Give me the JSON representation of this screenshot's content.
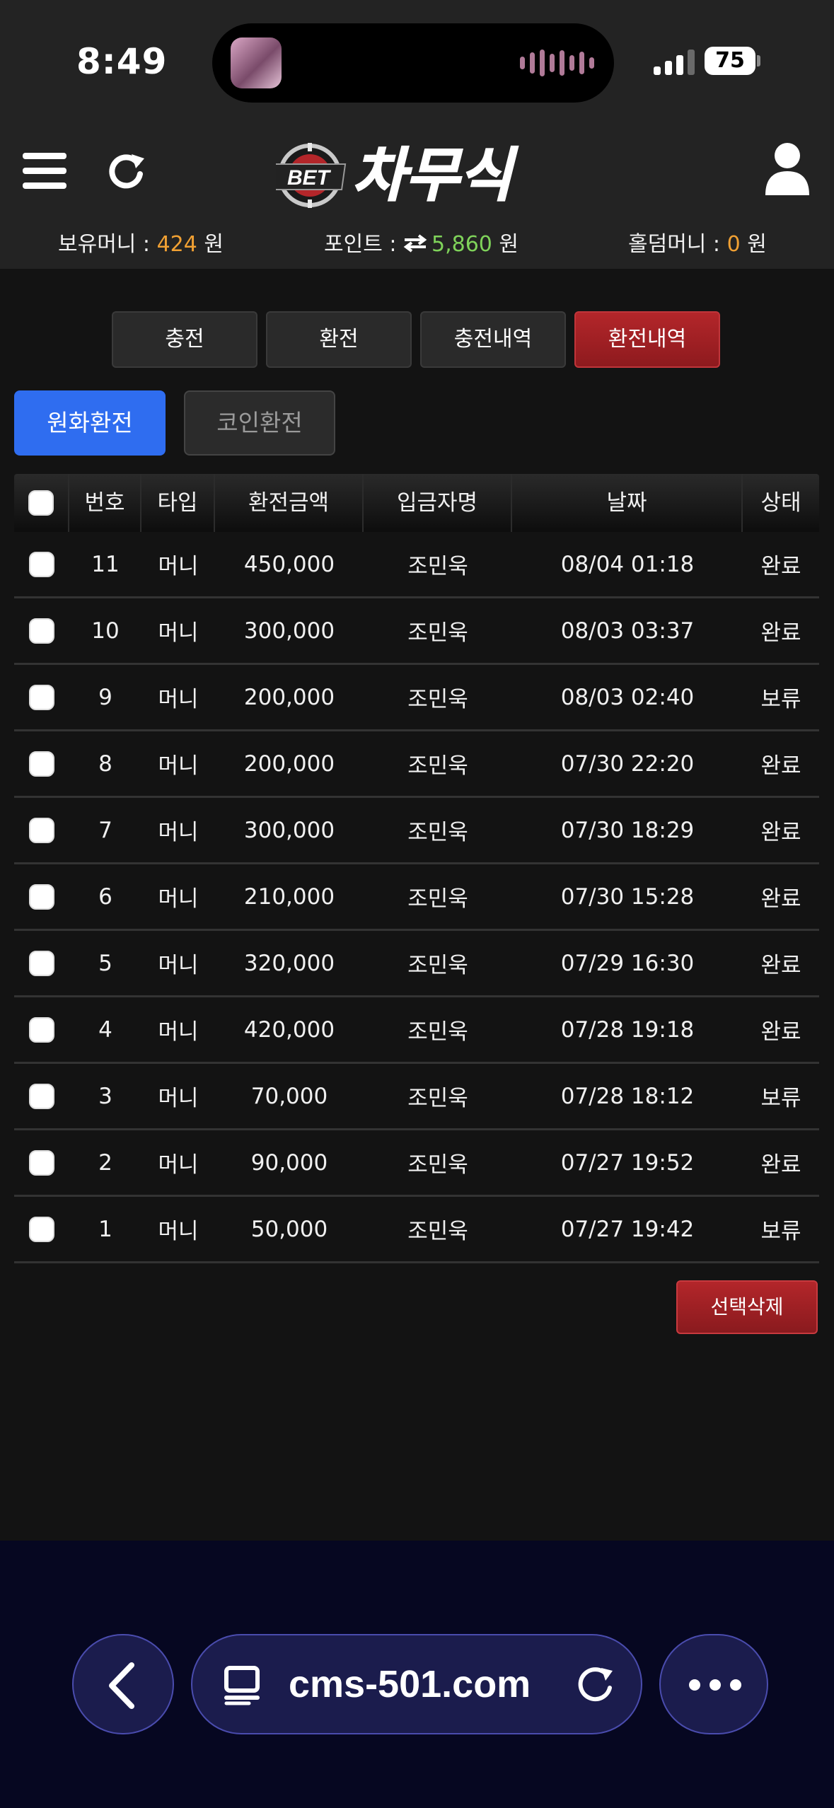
{
  "status_bar": {
    "time": "8:49",
    "battery": "75"
  },
  "header": {
    "logo_text": "차무식",
    "logo_badge": "BET",
    "balances": {
      "money_label": "보유머니 : ",
      "money_value": "424",
      "money_unit": " 원",
      "point_label": "포인트 : ",
      "point_value": "5,860",
      "point_unit": " 원",
      "holdem_label": "홀덤머니 : ",
      "holdem_value": "0",
      "holdem_unit": " 원"
    }
  },
  "tabs": [
    "충전",
    "환전",
    "충전내역",
    "환전내역"
  ],
  "subtabs": [
    "원화환전",
    "코인환전"
  ],
  "table": {
    "headers": [
      "번호",
      "타입",
      "환전금액",
      "입금자명",
      "날짜",
      "상태"
    ],
    "rows": [
      {
        "no": "11",
        "type": "머니",
        "amount": "450,000",
        "name": "조민욱",
        "date": "08/04 01:18",
        "status": "완료"
      },
      {
        "no": "10",
        "type": "머니",
        "amount": "300,000",
        "name": "조민욱",
        "date": "08/03 03:37",
        "status": "완료"
      },
      {
        "no": "9",
        "type": "머니",
        "amount": "200,000",
        "name": "조민욱",
        "date": "08/03 02:40",
        "status": "보류"
      },
      {
        "no": "8",
        "type": "머니",
        "amount": "200,000",
        "name": "조민욱",
        "date": "07/30 22:20",
        "status": "완료"
      },
      {
        "no": "7",
        "type": "머니",
        "amount": "300,000",
        "name": "조민욱",
        "date": "07/30 18:29",
        "status": "완료"
      },
      {
        "no": "6",
        "type": "머니",
        "amount": "210,000",
        "name": "조민욱",
        "date": "07/30 15:28",
        "status": "완료"
      },
      {
        "no": "5",
        "type": "머니",
        "amount": "320,000",
        "name": "조민욱",
        "date": "07/29 16:30",
        "status": "완료"
      },
      {
        "no": "4",
        "type": "머니",
        "amount": "420,000",
        "name": "조민욱",
        "date": "07/28 19:18",
        "status": "완료"
      },
      {
        "no": "3",
        "type": "머니",
        "amount": "70,000",
        "name": "조민욱",
        "date": "07/28 18:12",
        "status": "보류"
      },
      {
        "no": "2",
        "type": "머니",
        "amount": "90,000",
        "name": "조민욱",
        "date": "07/27 19:52",
        "status": "완료"
      },
      {
        "no": "1",
        "type": "머니",
        "amount": "50,000",
        "name": "조민욱",
        "date": "07/27 19:42",
        "status": "보류"
      }
    ]
  },
  "delete_button": "선택삭제",
  "browser": {
    "url": "cms-501.com"
  },
  "icons": {
    "menu": "hamburger-icon",
    "refresh": "refresh-icon",
    "user": "user-icon",
    "exchange": "exchange-arrows-icon",
    "back": "chevron-left-icon",
    "tabs": "tab-overview-icon",
    "reload": "reload-icon",
    "more": "more-dots-icon"
  },
  "colors": {
    "accent_blue": "#2f6df0",
    "accent_red": "#b3262a",
    "money_orange": "#f0a033",
    "point_green": "#7fd35a",
    "browser_bg": "#060721"
  }
}
